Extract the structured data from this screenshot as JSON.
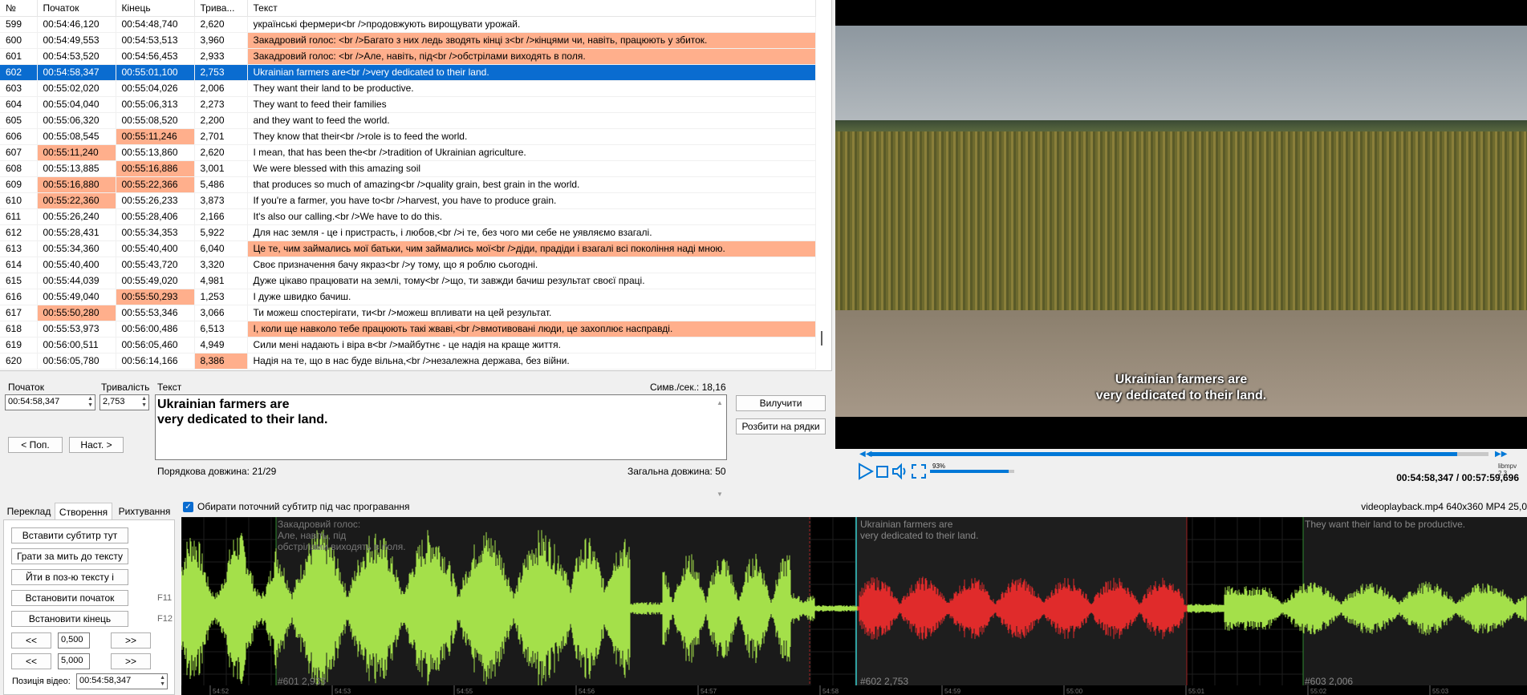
{
  "grid": {
    "columns": [
      "№",
      "Початок",
      "Кінець",
      "Трива...",
      "Текст"
    ],
    "rows": [
      {
        "n": "599",
        "start": "00:54:46,120",
        "end": "00:54:48,740",
        "dur": "2,620",
        "text": "українські фермери<br />продовжують вирощувати урожай.",
        "hl": []
      },
      {
        "n": "600",
        "start": "00:54:49,553",
        "end": "00:54:53,513",
        "dur": "3,960",
        "text": "Закадровий голос: <br />Багато з них ледь зводять кінці з<br />кінцями чи, навіть, працюють у збиток.",
        "hl": [
          "text"
        ]
      },
      {
        "n": "601",
        "start": "00:54:53,520",
        "end": "00:54:56,453",
        "dur": "2,933",
        "text": "Закадровий голос: <br />Але, навіть, під<br />обстрілами виходять в поля.",
        "hl": [
          "text"
        ]
      },
      {
        "n": "602",
        "start": "00:54:58,347",
        "end": "00:55:01,100",
        "dur": "2,753",
        "text": "Ukrainian farmers are<br />very dedicated to their land.",
        "hl": [],
        "selected": true
      },
      {
        "n": "603",
        "start": "00:55:02,020",
        "end": "00:55:04,026",
        "dur": "2,006",
        "text": "They want their land to be productive.",
        "hl": []
      },
      {
        "n": "604",
        "start": "00:55:04,040",
        "end": "00:55:06,313",
        "dur": "2,273",
        "text": "They want to feed their families",
        "hl": []
      },
      {
        "n": "605",
        "start": "00:55:06,320",
        "end": "00:55:08,520",
        "dur": "2,200",
        "text": "and they want to feed the world.",
        "hl": []
      },
      {
        "n": "606",
        "start": "00:55:08,545",
        "end": "00:55:11,246",
        "dur": "2,701",
        "text": "They know that their<br />role is to feed the world.",
        "hl": [
          "end"
        ]
      },
      {
        "n": "607",
        "start": "00:55:11,240",
        "end": "00:55:13,860",
        "dur": "2,620",
        "text": "I mean, that has been the<br />tradition of Ukrainian agriculture.",
        "hl": [
          "start"
        ]
      },
      {
        "n": "608",
        "start": "00:55:13,885",
        "end": "00:55:16,886",
        "dur": "3,001",
        "text": "We were blessed with this amazing soil",
        "hl": [
          "end"
        ]
      },
      {
        "n": "609",
        "start": "00:55:16,880",
        "end": "00:55:22,366",
        "dur": "5,486",
        "text": "that produces so much of amazing<br />quality grain, best grain in the world.",
        "hl": [
          "start",
          "end"
        ]
      },
      {
        "n": "610",
        "start": "00:55:22,360",
        "end": "00:55:26,233",
        "dur": "3,873",
        "text": "If you're a farmer, you have to<br />harvest, you have to produce grain.",
        "hl": [
          "start"
        ]
      },
      {
        "n": "611",
        "start": "00:55:26,240",
        "end": "00:55:28,406",
        "dur": "2,166",
        "text": "It's also our calling.<br />We have to do this.",
        "hl": []
      },
      {
        "n": "612",
        "start": "00:55:28,431",
        "end": "00:55:34,353",
        "dur": "5,922",
        "text": "Для нас земля - це і пристрасть, і любов,<br />і те, без чого ми себе не уявляємо взагалі.",
        "hl": []
      },
      {
        "n": "613",
        "start": "00:55:34,360",
        "end": "00:55:40,400",
        "dur": "6,040",
        "text": "Це те, чим займались мої батьки, чим займались мої<br />діди, прадіди і взагалі всі покоління наді мною.",
        "hl": [
          "text"
        ]
      },
      {
        "n": "614",
        "start": "00:55:40,400",
        "end": "00:55:43,720",
        "dur": "3,320",
        "text": "Своє призначення бачу якраз<br />у тому, що я роблю сьогодні.",
        "hl": []
      },
      {
        "n": "615",
        "start": "00:55:44,039",
        "end": "00:55:49,020",
        "dur": "4,981",
        "text": "Дуже цікаво працювати на землі, тому<br />що, ти завжди бачиш результат своєї праці.",
        "hl": []
      },
      {
        "n": "616",
        "start": "00:55:49,040",
        "end": "00:55:50,293",
        "dur": "1,253",
        "text": "І дуже швидко бачиш.",
        "hl": [
          "end"
        ]
      },
      {
        "n": "617",
        "start": "00:55:50,280",
        "end": "00:55:53,346",
        "dur": "3,066",
        "text": "Ти можеш спостерігати, ти<br />можеш впливати на цей результат.",
        "hl": [
          "start"
        ]
      },
      {
        "n": "618",
        "start": "00:55:53,973",
        "end": "00:56:00,486",
        "dur": "6,513",
        "text": "І, коли ще навколо тебе працюють такі жваві,<br />вмотивовані люди, це захоплює насправді.",
        "hl": [
          "text"
        ]
      },
      {
        "n": "619",
        "start": "00:56:00,511",
        "end": "00:56:05,460",
        "dur": "4,949",
        "text": "Сили мені надають і віра в<br />майбутнє - це надія на краще життя.",
        "hl": []
      },
      {
        "n": "620",
        "start": "00:56:05,780",
        "end": "00:56:14,166",
        "dur": "8,386",
        "text": "Надія на те, що в нас буде вільна,<br />незалежна держава, без війни.",
        "hl": [
          "dur"
        ]
      }
    ]
  },
  "editor": {
    "start_label": "Початок",
    "start_value": "00:54:58,347",
    "duration_label": "Тривалість",
    "duration_value": "2,753",
    "text_label": "Текст",
    "cps_label": "Симв./сек.: 18,16",
    "text_line1": "Ukrainian farmers are",
    "text_line2": "very dedicated to their land.",
    "line_length": "Порядкова довжина: 21/29",
    "total_length": "Загальна довжина: 50",
    "prev_button": "< Поп.",
    "next_button": "Наст. >",
    "delete_button": "Вилучити",
    "split_button": "Розбити на рядки"
  },
  "video": {
    "subtitle_line1": "Ukrainian farmers are",
    "subtitle_line2": "very dedicated to their land.",
    "progress": 0.95,
    "volume_pct": "93%",
    "volume": 0.93,
    "time": "00:54:58,347 / 00:57:59,696",
    "engine": "libmpv 2.3",
    "file_info": "videoplayback.mp4 640x360 MP4 25,0"
  },
  "tabs": [
    "Переклад",
    "Створення",
    "Рихтування"
  ],
  "create_panel": {
    "insert_button": "Вставити субтитр тут",
    "play_button": "Грати за мить до тексту",
    "goto_button": "Йти в поз-ю тексту і",
    "set_start_button": "Встановити початок",
    "set_start_key": "F11",
    "set_end_button": "Встановити кінець",
    "set_end_key": "F12",
    "step1_value": "0,500",
    "step2_value": "5,000",
    "back_label": "<<",
    "fwd_label": ">>",
    "video_pos_label": "Позиція відео:",
    "video_pos_value": "00:54:58,347"
  },
  "waveform": {
    "follow_label": "Обирати поточний субтитр під час програвання",
    "sub601_line1": "Закадровий голос:",
    "sub601_line2": "Але, навіть, під",
    "sub601_line3": "обстрілами виходять в поля.",
    "sub601_num": "#601  2,933",
    "sub602_line1": "Ukrainian farmers are",
    "sub602_line2": "very dedicated to their land.",
    "sub602_num": "#602  2,753",
    "sub603_line1": "They want their land to be productive.",
    "sub603_num": "#603  2,006",
    "ticks": [
      "54:52",
      "54:53",
      "54:55",
      "54:56",
      "54:57",
      "54:58",
      "54:59",
      "55:00",
      "55:01",
      "55:02",
      "55:03"
    ],
    "colors": {
      "wave": "#a4e04a",
      "selected": "#e02b2b",
      "bg": "#000000"
    }
  }
}
